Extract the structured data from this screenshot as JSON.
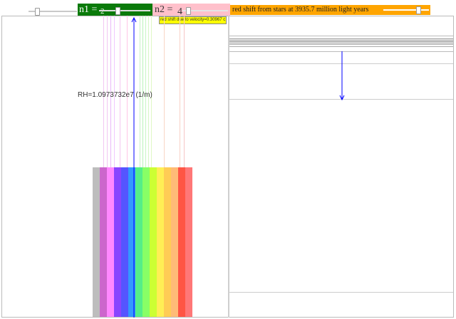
{
  "controls": {
    "n1_label": "n1 =",
    "n1_value": "2",
    "n2_label": "n2 =",
    "n2_value": "4",
    "redshift_label": "red shift from stars at 3935.7 million light years",
    "velocity_label": "red shift due to velocity=0.30967 c"
  },
  "constants": {
    "rydberg_label": "RH=1.0973732e7 (1/m)"
  },
  "colors": {
    "n1_bg": "#0a7a0a",
    "n2_bg": "#ffc0cb",
    "redshift_bg": "#ffa500",
    "velocity_bg": "#ffff00",
    "arrow": "#0000ff"
  },
  "spectrum_colors": [
    "#bdbdbd",
    "#cc66cc",
    "#ff88ff",
    "#8844ff",
    "#5555ff",
    "#3399ff",
    "#55ee88",
    "#88ff66",
    "#ccff33",
    "#ffee55",
    "#ffcc55",
    "#ffbb77",
    "#ff5544",
    "#ff7777"
  ]
}
